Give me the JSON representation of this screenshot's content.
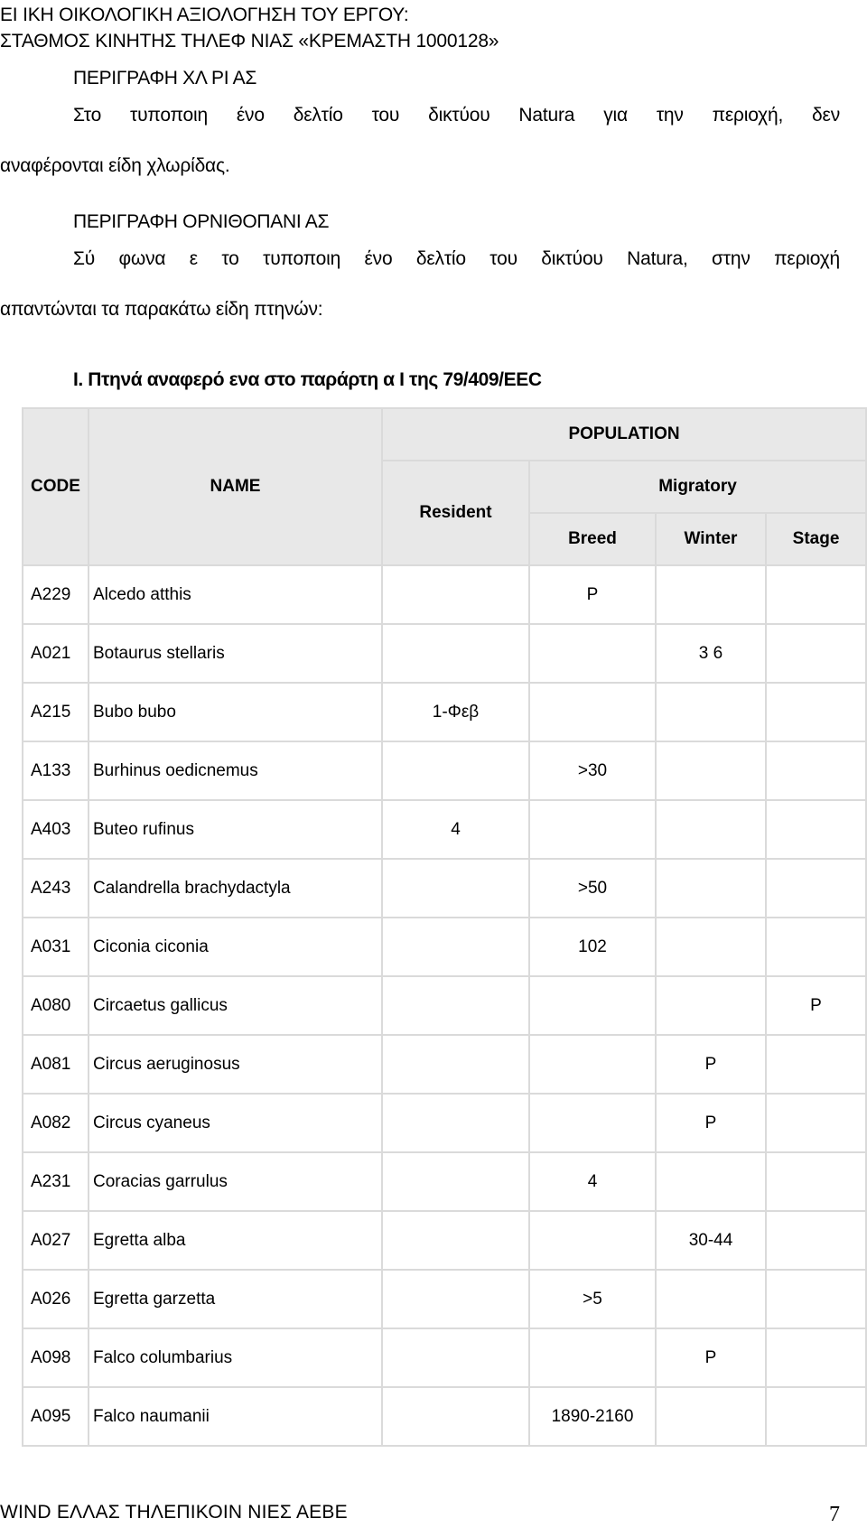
{
  "header": {
    "line1": "ΕΙ  ΙΚΗ ΟΙΚΟΛΟΓΙΚΗ ΑΞΙΟΛΟΓΗΣΗ ΤΟΥ ΕΡΓΟΥ:",
    "line2": "ΣΤΑΘΜΟΣ ΚΙΝΗΤΗΣ ΤΗΛΕΦ   ΝΙΑΣ «ΚΡΕΜΑΣΤΗ 1000128»"
  },
  "flora": {
    "heading": "ΠΕΡΙΓΡΑΦΗ ΧΛ   ΡΙ  ΑΣ",
    "line1": "Στο τυποποιη ένο δελτίο του δικτύου Natura για την περιοχή, δεν",
    "line2": "αναφέρονται είδη χλωρίδας."
  },
  "avifauna": {
    "heading": "ΠΕΡΙΓΡΑΦΗ ΟΡΝΙΘΟΠΑΝΙ   ΑΣ",
    "line1": "Σύ φωνα   ε το τυποποιη ένο δελτίο του δικτύου Natura, στην περιοχή",
    "line2": "απαντώνται τα παρακάτω είδη πτηνών:"
  },
  "table_caption": "Ι. Πτηνά αναφερό  ενα στο παράρτη  α Ι της 79/409/EEC",
  "table": {
    "headers": {
      "code": "CODE",
      "name": "NAME",
      "population": "POPULATION",
      "resident": "Resident",
      "migratory": "Migratory",
      "breed": "Breed",
      "winter": "Winter",
      "stage": "Stage"
    },
    "rows": [
      {
        "code": "A229",
        "name": "Alcedo atthis",
        "resident": "",
        "breed": "P",
        "winter": "",
        "stage": ""
      },
      {
        "code": "A021",
        "name": "Botaurus stellaris",
        "resident": "",
        "breed": "",
        "winter": "3 6",
        "stage": ""
      },
      {
        "code": "A215",
        "name": "Bubo bubo",
        "resident": "1-Φεβ",
        "breed": "",
        "winter": "",
        "stage": ""
      },
      {
        "code": "A133",
        "name": "Burhinus oedicnemus",
        "resident": "",
        "breed": ">30",
        "winter": "",
        "stage": ""
      },
      {
        "code": "A403",
        "name": "Buteo rufinus",
        "resident": "4",
        "breed": "",
        "winter": "",
        "stage": ""
      },
      {
        "code": "A243",
        "name": "Calandrella brachydactyla",
        "resident": "",
        "breed": ">50",
        "winter": "",
        "stage": ""
      },
      {
        "code": "A031",
        "name": "Ciconia ciconia",
        "resident": "",
        "breed": "102",
        "winter": "",
        "stage": ""
      },
      {
        "code": "A080",
        "name": "Circaetus gallicus",
        "resident": "",
        "breed": "",
        "winter": "",
        "stage": "P"
      },
      {
        "code": "A081",
        "name": "Circus aeruginosus",
        "resident": "",
        "breed": "",
        "winter": "P",
        "stage": ""
      },
      {
        "code": "A082",
        "name": "Circus cyaneus",
        "resident": "",
        "breed": "",
        "winter": "P",
        "stage": ""
      },
      {
        "code": "A231",
        "name": "Coracias garrulus",
        "resident": "",
        "breed": "4",
        "winter": "",
        "stage": ""
      },
      {
        "code": "A027",
        "name": "Egretta alba",
        "resident": "",
        "breed": "",
        "winter": "30-44",
        "stage": ""
      },
      {
        "code": "A026",
        "name": "Egretta garzetta",
        "resident": "",
        "breed": ">5",
        "winter": "",
        "stage": ""
      },
      {
        "code": "A098",
        "name": "Falco columbarius",
        "resident": "",
        "breed": "",
        "winter": "P",
        "stage": ""
      },
      {
        "code": "A095",
        "name": "Falco naumanii",
        "resident": "",
        "breed": "1890-2160",
        "winter": "",
        "stage": ""
      }
    ]
  },
  "footer": {
    "company": "WIND ΕΛΛΑΣ ΤΗΛΕΠΙΚΟΙΝ   ΝΙΕΣ ΑΕΒΕ",
    "page_number": "7"
  }
}
